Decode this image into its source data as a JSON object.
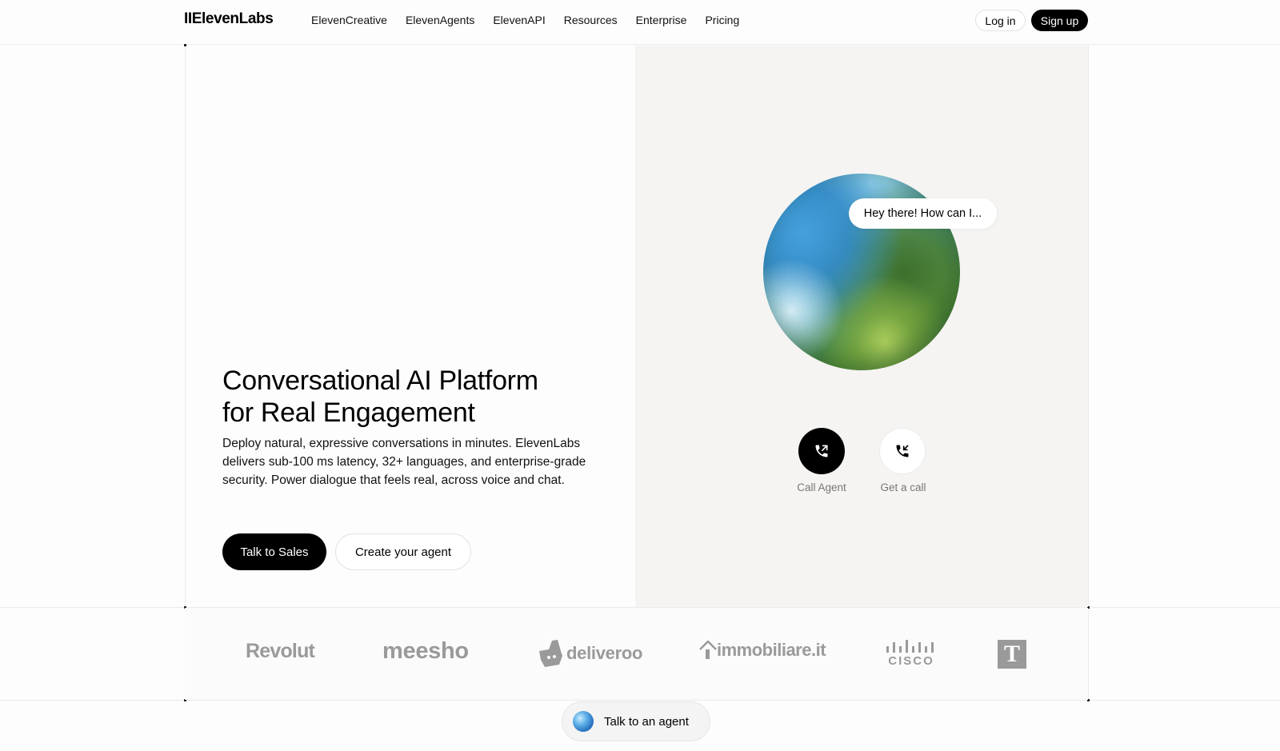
{
  "nav": {
    "logo": "IIElevenLabs",
    "items": [
      "ElevenCreative",
      "ElevenAgents",
      "ElevenAPI",
      "Resources",
      "Enterprise",
      "Pricing"
    ],
    "login": "Log in",
    "signup": "Sign up"
  },
  "hero": {
    "title_line1": "Conversational AI Platform",
    "title_line2": "for Real Engagement",
    "description": "Deploy natural, expressive conversations in minutes. ElevenLabs delivers sub-100 ms latency, 32+ languages, and enterprise-grade security. Power dialogue that feels real, across voice and chat.",
    "primary_cta": "Talk to Sales",
    "secondary_cta": "Create your agent"
  },
  "demo": {
    "bubble": "Hey there! How can I...",
    "call_agent": "Call Agent",
    "get_call": "Get a call"
  },
  "logos": {
    "revolut": "Revolut",
    "meesho": "meesho",
    "deliveroo": "deliveroo",
    "immobiliare": "immobiliare.it",
    "cisco": "CISCO",
    "tmobile": "T"
  },
  "widget": {
    "label": "Talk to an agent"
  },
  "colors": {
    "accent": "#000000",
    "panel": "#f5f4f2",
    "logo_gray": "#9a9a9a"
  }
}
